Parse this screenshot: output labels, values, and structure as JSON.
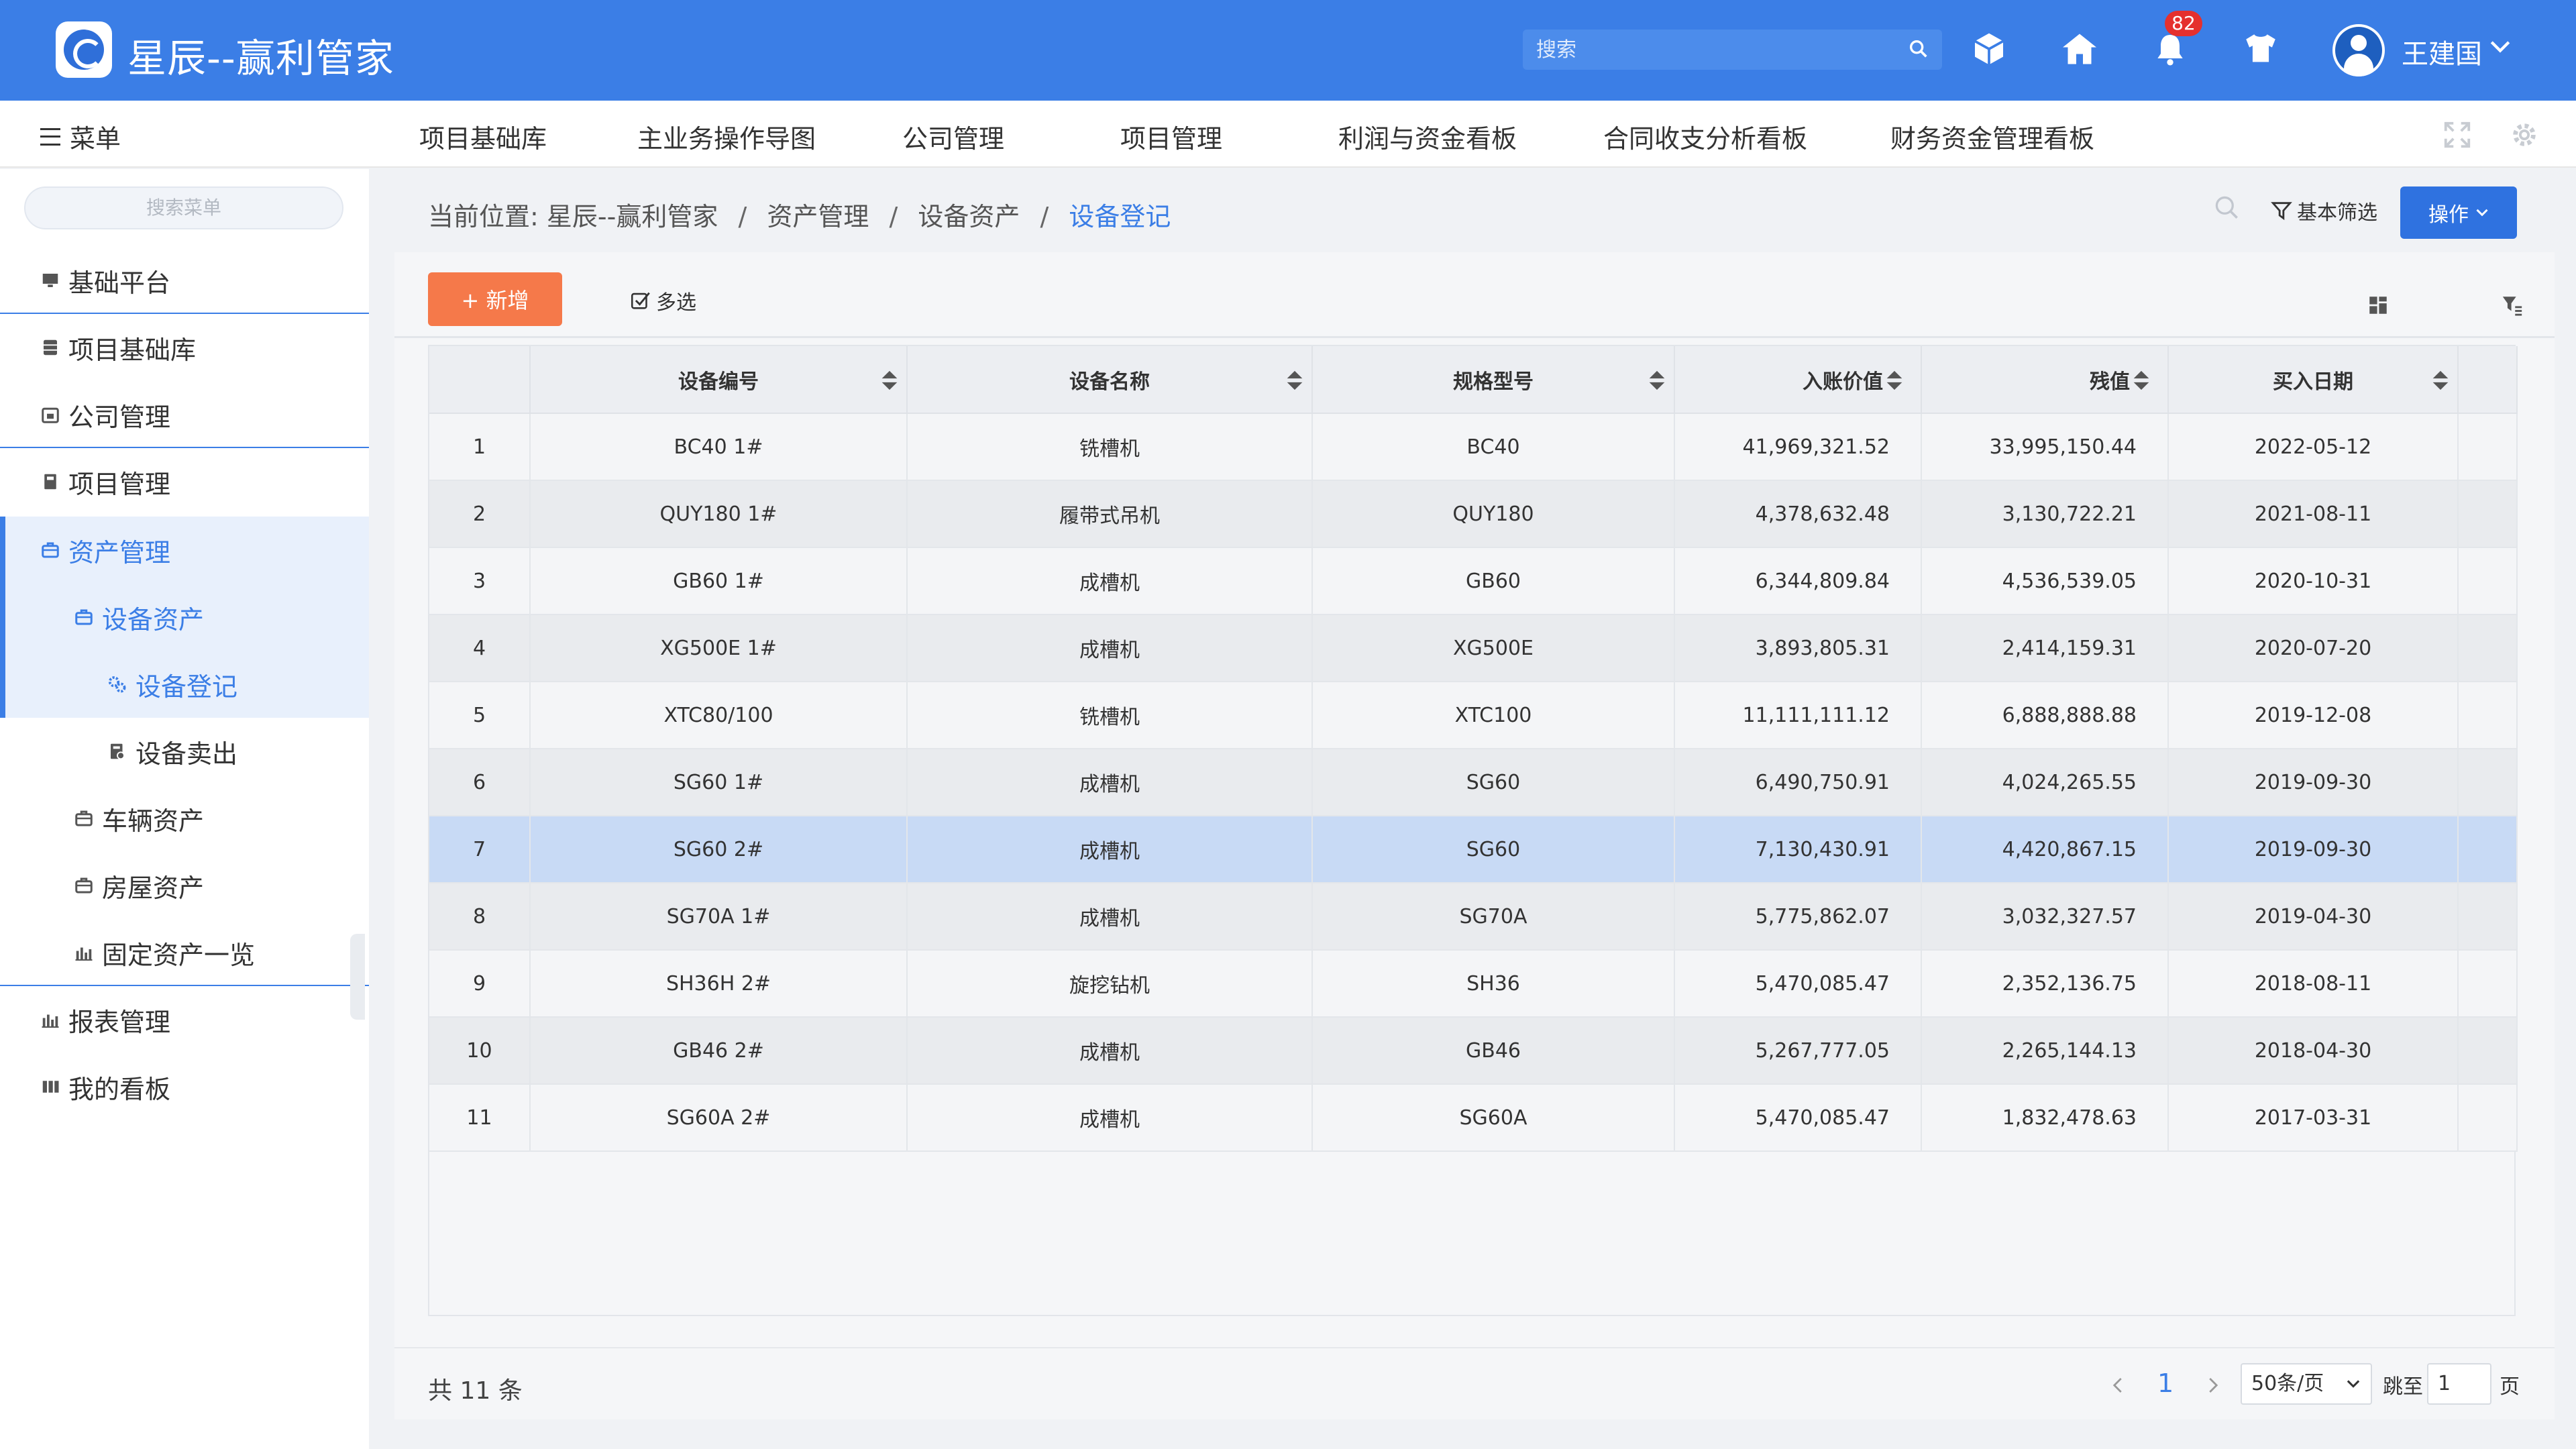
{
  "header": {
    "title": "星辰--赢利管家",
    "search_placeholder": "搜索",
    "notification_count": "82",
    "user_name": "王建国"
  },
  "nav": {
    "menu_label": "菜单",
    "items": [
      "项目基础库",
      "主业务操作导图",
      "公司管理",
      "项目管理",
      "利润与资金看板",
      "合同收支分析看板",
      "财务资金管理看板"
    ]
  },
  "sidebar": {
    "search_placeholder": "搜索菜单",
    "items": [
      {
        "label": "基础平台",
        "icon": "monitor-icon"
      },
      {
        "label": "项目基础库",
        "icon": "database-icon"
      },
      {
        "label": "公司管理",
        "icon": "calendar-icon"
      },
      {
        "label": "项目管理",
        "icon": "book-icon"
      },
      {
        "label": "资产管理",
        "icon": "briefcase-icon"
      },
      {
        "label": "设备资产",
        "icon": "briefcase-icon"
      },
      {
        "label": "设备登记",
        "icon": "gears-icon"
      },
      {
        "label": "设备卖出",
        "icon": "document-icon"
      },
      {
        "label": "车辆资产",
        "icon": "briefcase-icon"
      },
      {
        "label": "房屋资产",
        "icon": "briefcase-icon"
      },
      {
        "label": "固定资产一览",
        "icon": "bar-chart-icon"
      },
      {
        "label": "报表管理",
        "icon": "bar-chart-icon"
      },
      {
        "label": "我的看板",
        "icon": "columns-icon"
      }
    ]
  },
  "breadcrumb": {
    "prefix": "当前位置:",
    "items": [
      "星辰--赢利管家",
      "资产管理",
      "设备资产"
    ],
    "current": "设备登记",
    "separator": "/"
  },
  "actions": {
    "basic_filter": "基本筛选",
    "operate": "操作",
    "add": "+ 新增",
    "multi_select": "多选"
  },
  "table": {
    "columns": [
      "",
      "设备编号",
      "设备名称",
      "规格型号",
      "入账价值",
      "残值",
      "买入日期"
    ],
    "rows": [
      [
        "1",
        "BC40 1#",
        "铣槽机",
        "BC40",
        "41,969,321.52",
        "33,995,150.44",
        "2022-05-12"
      ],
      [
        "2",
        "QUY180 1#",
        "履带式吊机",
        "QUY180",
        "4,378,632.48",
        "3,130,722.21",
        "2021-08-11"
      ],
      [
        "3",
        "GB60 1#",
        "成槽机",
        "GB60",
        "6,344,809.84",
        "4,536,539.05",
        "2020-10-31"
      ],
      [
        "4",
        "XG500E 1#",
        "成槽机",
        "XG500E",
        "3,893,805.31",
        "2,414,159.31",
        "2020-07-20"
      ],
      [
        "5",
        "XTC80/100",
        "铣槽机",
        "XTC100",
        "11,111,111.12",
        "6,888,888.88",
        "2019-12-08"
      ],
      [
        "6",
        "SG60 1#",
        "成槽机",
        "SG60",
        "6,490,750.91",
        "4,024,265.55",
        "2019-09-30"
      ],
      [
        "7",
        "SG60 2#",
        "成槽机",
        "SG60",
        "7,130,430.91",
        "4,420,867.15",
        "2019-09-30"
      ],
      [
        "8",
        "SG70A 1#",
        "成槽机",
        "SG70A",
        "5,775,862.07",
        "3,032,327.57",
        "2019-04-30"
      ],
      [
        "9",
        "SH36H 2#",
        "旋挖钻机",
        "SH36",
        "5,470,085.47",
        "2,352,136.75",
        "2018-08-11"
      ],
      [
        "10",
        "GB46 2#",
        "成槽机",
        "GB46",
        "5,267,777.05",
        "2,265,144.13",
        "2018-04-30"
      ],
      [
        "11",
        "SG60A 2#",
        "成槽机",
        "SG60A",
        "5,470,085.47",
        "1,832,478.63",
        "2017-03-31"
      ]
    ],
    "selected_row": 7
  },
  "pagination": {
    "total": "共 11 条",
    "current_page": "1",
    "page_size": "50条/页",
    "jump_label": "跳至",
    "jump_value": "1",
    "page_suffix": "页"
  },
  "colors": {
    "primary": "#3b7ee6",
    "add_button": "#f5794a",
    "badge": "#e5302e",
    "row_selected": "#c8daf5"
  }
}
